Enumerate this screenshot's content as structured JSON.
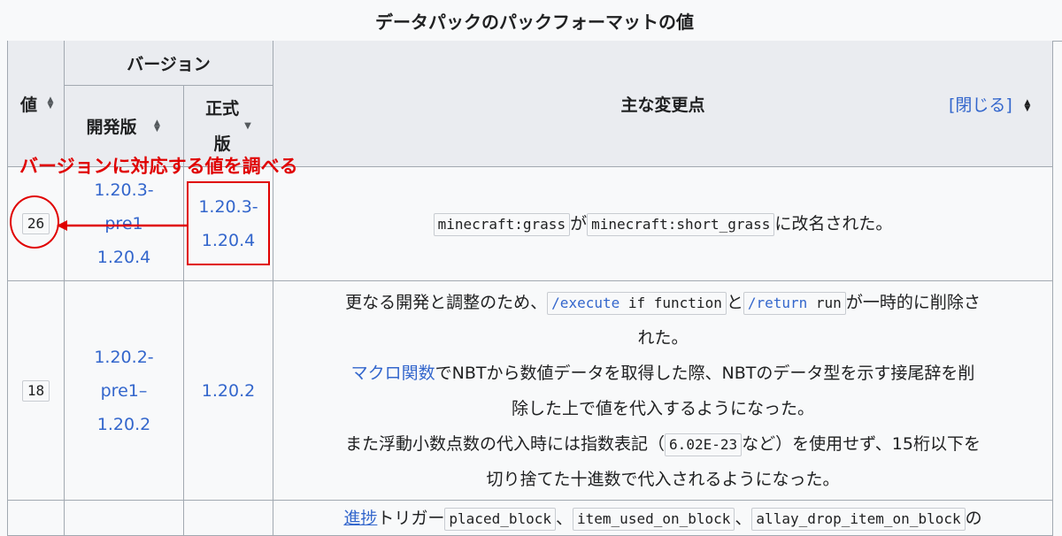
{
  "table": {
    "caption": "データパックのパックフォーマットの値",
    "headers": {
      "value": "値",
      "version": "バージョン",
      "dev": "開発版",
      "release_line1": "正式",
      "release_line2": "版",
      "changes": "主な変更点",
      "toggle": "[閉じる]"
    },
    "rows": [
      {
        "value": "26",
        "dev_line1": "1.20.3-",
        "dev_line2": "pre1",
        "dev_line3": "1.20.4",
        "release_line1": "1.20.3-",
        "release_line2": "1.20.4",
        "code1": "minecraft:grass",
        "join1": "が",
        "code2": "minecraft:short_grass",
        "tail": "に改名された。"
      },
      {
        "value": "18",
        "dev_line1": "1.20.2-",
        "dev_line2": "pre1–",
        "dev_line3": "1.20.2",
        "release": "1.20.2",
        "l1_pre": "更なる開発と調整のため、",
        "l1_code1_kw": "/execute",
        "l1_code1_rest": " if function",
        "l1_mid": "と",
        "l1_code2_kw": "/return",
        "l1_code2_rest": " run",
        "l1_post": "が一時的に削除さ",
        "l2": "れた。",
        "l3_link": "マクロ関数",
        "l3_rest": "でNBTから数値データを取得した際、NBTのデータ型を示す接尾辞を削",
        "l4": "除した上で値を代入するようになった。",
        "l5_pre": "また浮動小数点数の代入時には指数表記（",
        "l5_code": "6.02E-23",
        "l5_post": "など）を使用せず、15桁以下を",
        "l6": "切り捨てた十進数で代入されるようになった。"
      },
      {
        "c_link": "進捗",
        "c_text": "トリガー",
        "c_code1": "placed_block",
        "c_code2": "item_used_on_block",
        "c_code3": "allay_drop_item_on_block",
        "c_tail": "の"
      }
    ]
  },
  "annotation": {
    "label": "バージョンに対応する値を調べる",
    "color": "#e00000"
  }
}
